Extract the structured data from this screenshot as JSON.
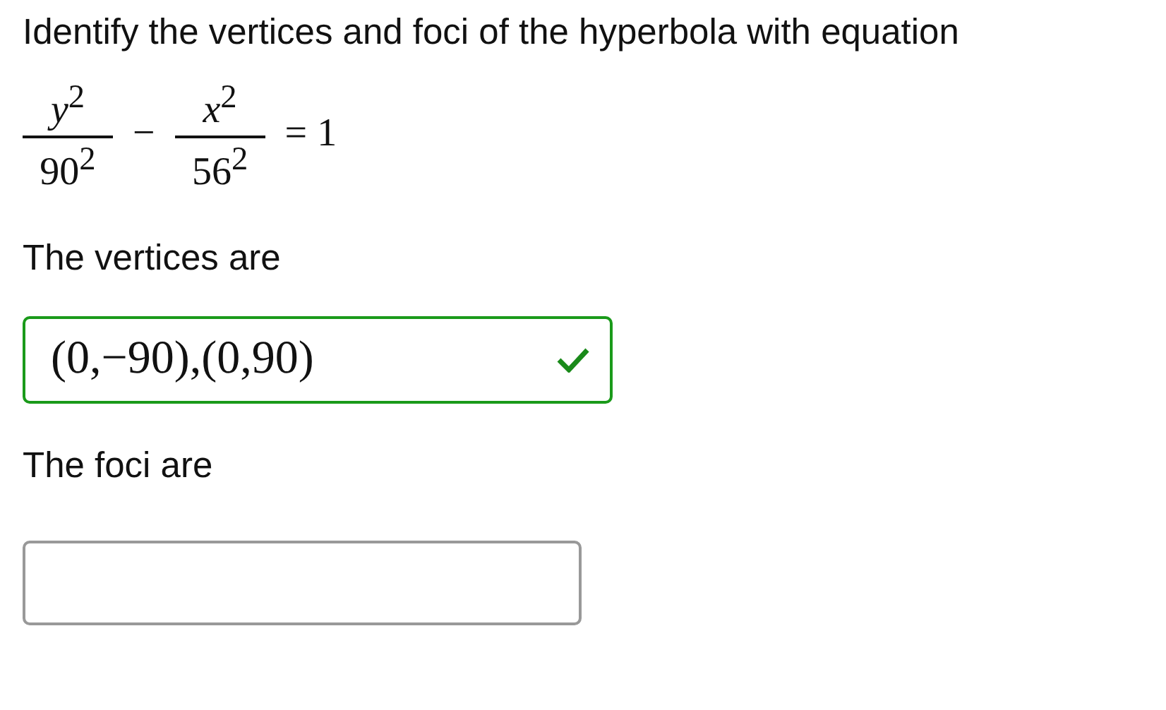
{
  "question": "Identify the vertices and foci of the hyperbola with equation",
  "equation": {
    "terms": [
      {
        "numerator": "*y*$^{2}$",
        "denominator": "90$^{2}$"
      },
      {
        "numerator": "*x*$^{2}$",
        "denominator": "56$^{2}$"
      }
    ],
    "operator": "−",
    "rhs": "= 1"
  },
  "answers": [
    {
      "label": "The vertices are",
      "value": "(0,−90),(0,90)",
      "correct": true
    },
    {
      "label": "The foci are",
      "correct": false
    }
  ]
}
